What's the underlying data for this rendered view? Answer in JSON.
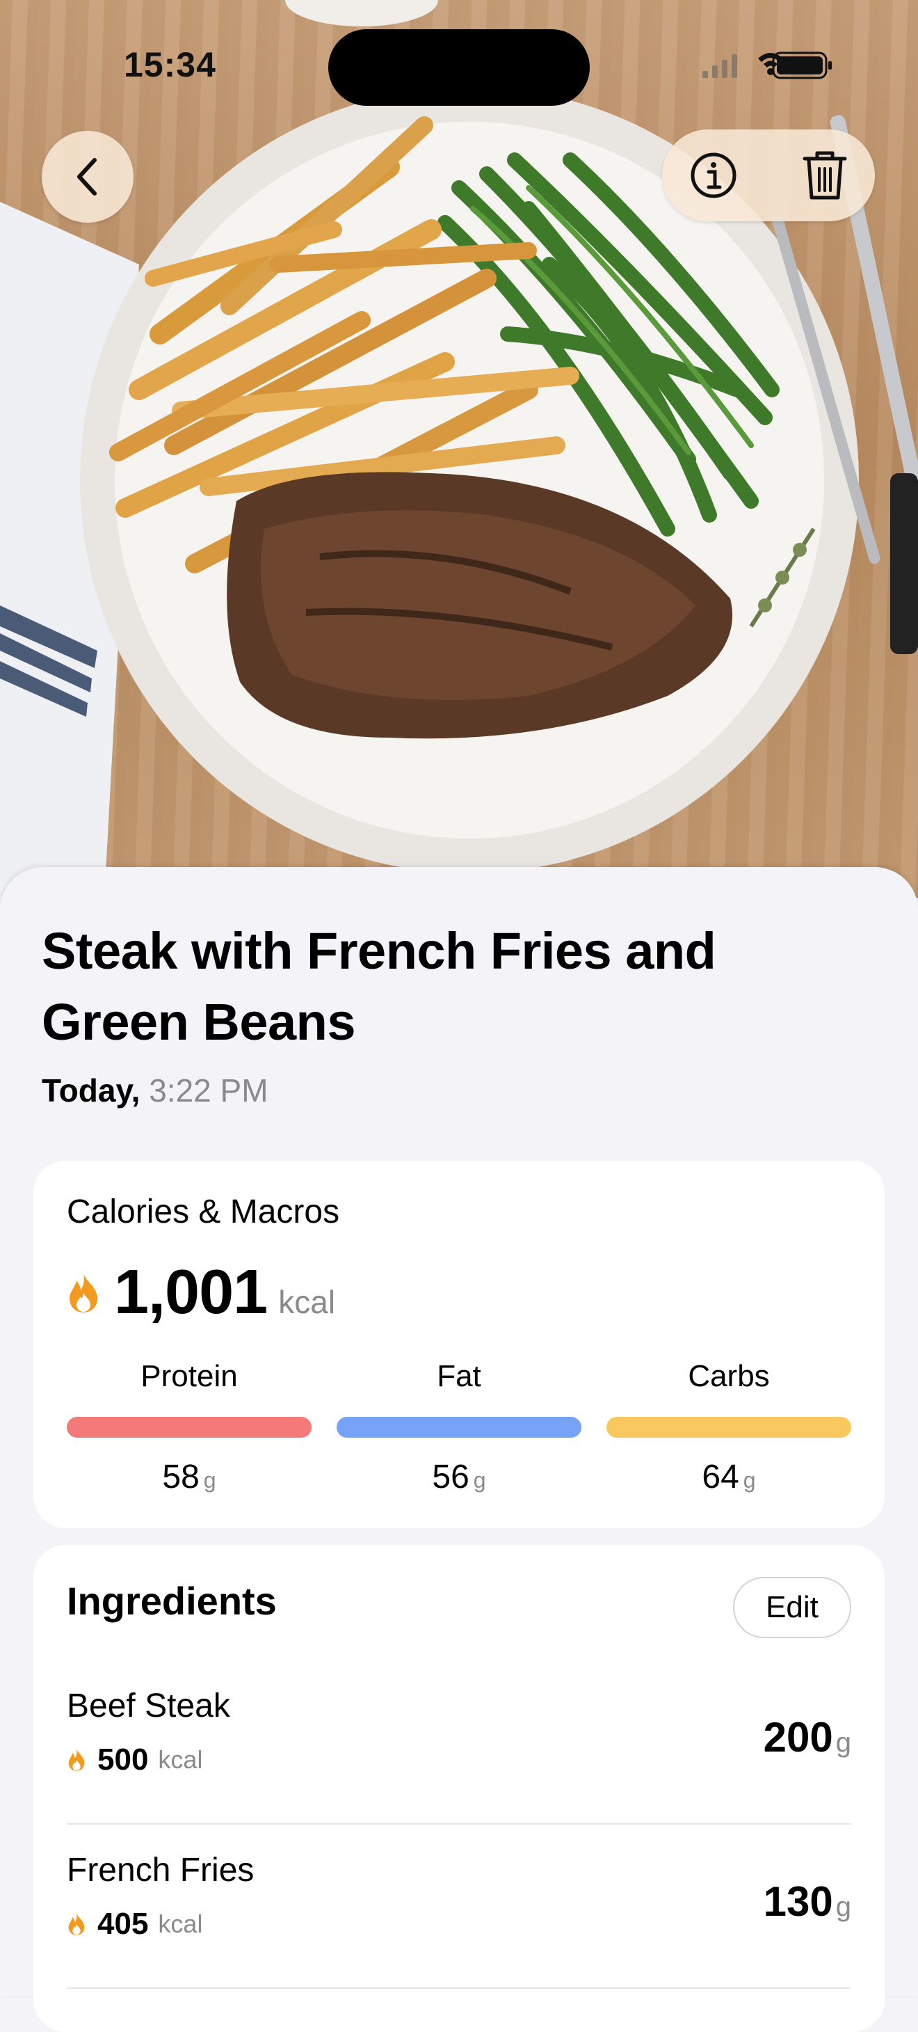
{
  "status_bar": {
    "time": "15:34"
  },
  "meal": {
    "title": "Steak with French Fries and Green Beans",
    "day": "Today,",
    "time": "3:22 PM"
  },
  "macros": {
    "heading": "Calories & Macros",
    "calories": "1,001",
    "calories_unit": "kcal",
    "items": [
      {
        "label": "Protein",
        "value": "58",
        "unit": "g",
        "color": "#f47a7a"
      },
      {
        "label": "Fat",
        "value": "56",
        "unit": "g",
        "color": "#76a2f7"
      },
      {
        "label": "Carbs",
        "value": "64",
        "unit": "g",
        "color": "#f9c85f"
      }
    ]
  },
  "ingredients": {
    "heading": "Ingredients",
    "edit_label": "Edit",
    "items": [
      {
        "name": "Beef Steak",
        "kcal": "500",
        "kcal_unit": "kcal",
        "weight": "200",
        "weight_unit": "g"
      },
      {
        "name": "French Fries",
        "kcal": "405",
        "kcal_unit": "kcal",
        "weight": "130",
        "weight_unit": "g"
      }
    ]
  },
  "icons": {
    "back": "chevron-left-icon",
    "info": "info-icon",
    "delete": "trash-icon",
    "calories": "flame-icon"
  },
  "colors": {
    "accent_flame": "#f39a1e",
    "sheet_bg": "#f4f4f8",
    "card_bg": "#ffffff"
  }
}
